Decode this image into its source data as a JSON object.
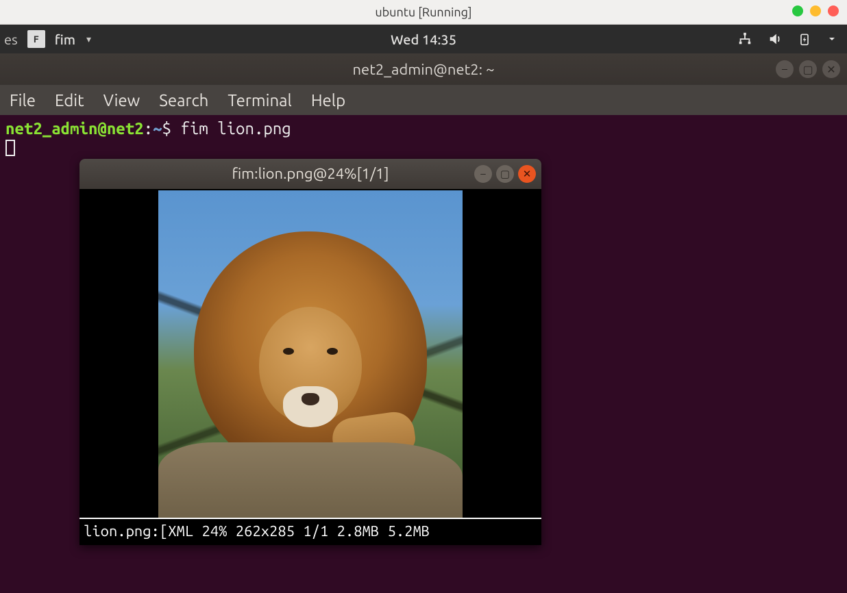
{
  "host": {
    "title": "ubuntu [Running]"
  },
  "panel": {
    "left_cut": "es",
    "app_name": "fim",
    "clock": "Wed 14:35"
  },
  "terminal": {
    "title": "net2_admin@net2: ~",
    "menu": {
      "file": "File",
      "edit": "Edit",
      "view": "View",
      "search": "Search",
      "terminal": "Terminal",
      "help": "Help"
    },
    "prompt": {
      "user_host": "net2_admin@net2",
      "sep": ":",
      "path": "~",
      "sigil": "$",
      "command": "fim lion.png"
    }
  },
  "fim": {
    "title": "fim:lion.png@24%[1/1]",
    "status": "lion.png:[XML 24% 262x285 1/1 2.8MB 5.2MB",
    "image_alt": "lion photo"
  }
}
